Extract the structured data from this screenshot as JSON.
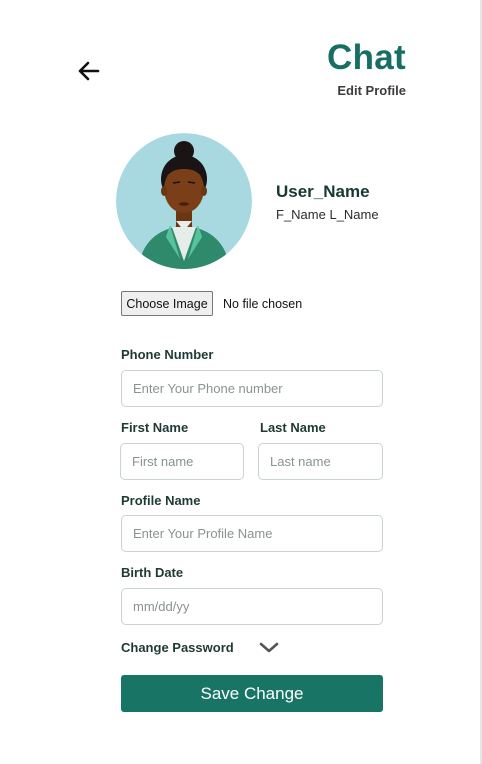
{
  "header": {
    "title": "Chat",
    "subtitle": "Edit Profile",
    "back_icon": "arrow-left-icon",
    "accent_color": "#176f63"
  },
  "profile": {
    "user_name": "User_Name",
    "full_name": "F_Name L_Name",
    "avatar_icon": "person-avatar"
  },
  "file_upload": {
    "button_label": "Choose Image",
    "status": "No file chosen"
  },
  "form": {
    "phone": {
      "label": "Phone Number",
      "placeholder": "Enter Your Phone number",
      "value": ""
    },
    "first_name": {
      "label": "First Name",
      "placeholder": "First name",
      "value": ""
    },
    "last_name": {
      "label": "Last Name",
      "placeholder": "Last name",
      "value": ""
    },
    "profile_name": {
      "label": "Profile Name",
      "placeholder": "Enter Your Profile Name",
      "value": ""
    },
    "birth_date": {
      "label": "Birth Date",
      "placeholder": "mm/dd/yy",
      "value": ""
    },
    "change_password": {
      "label": "Change Password",
      "icon": "chevron-down-icon"
    },
    "save_label": "Save Change",
    "save_color": "#187565"
  }
}
